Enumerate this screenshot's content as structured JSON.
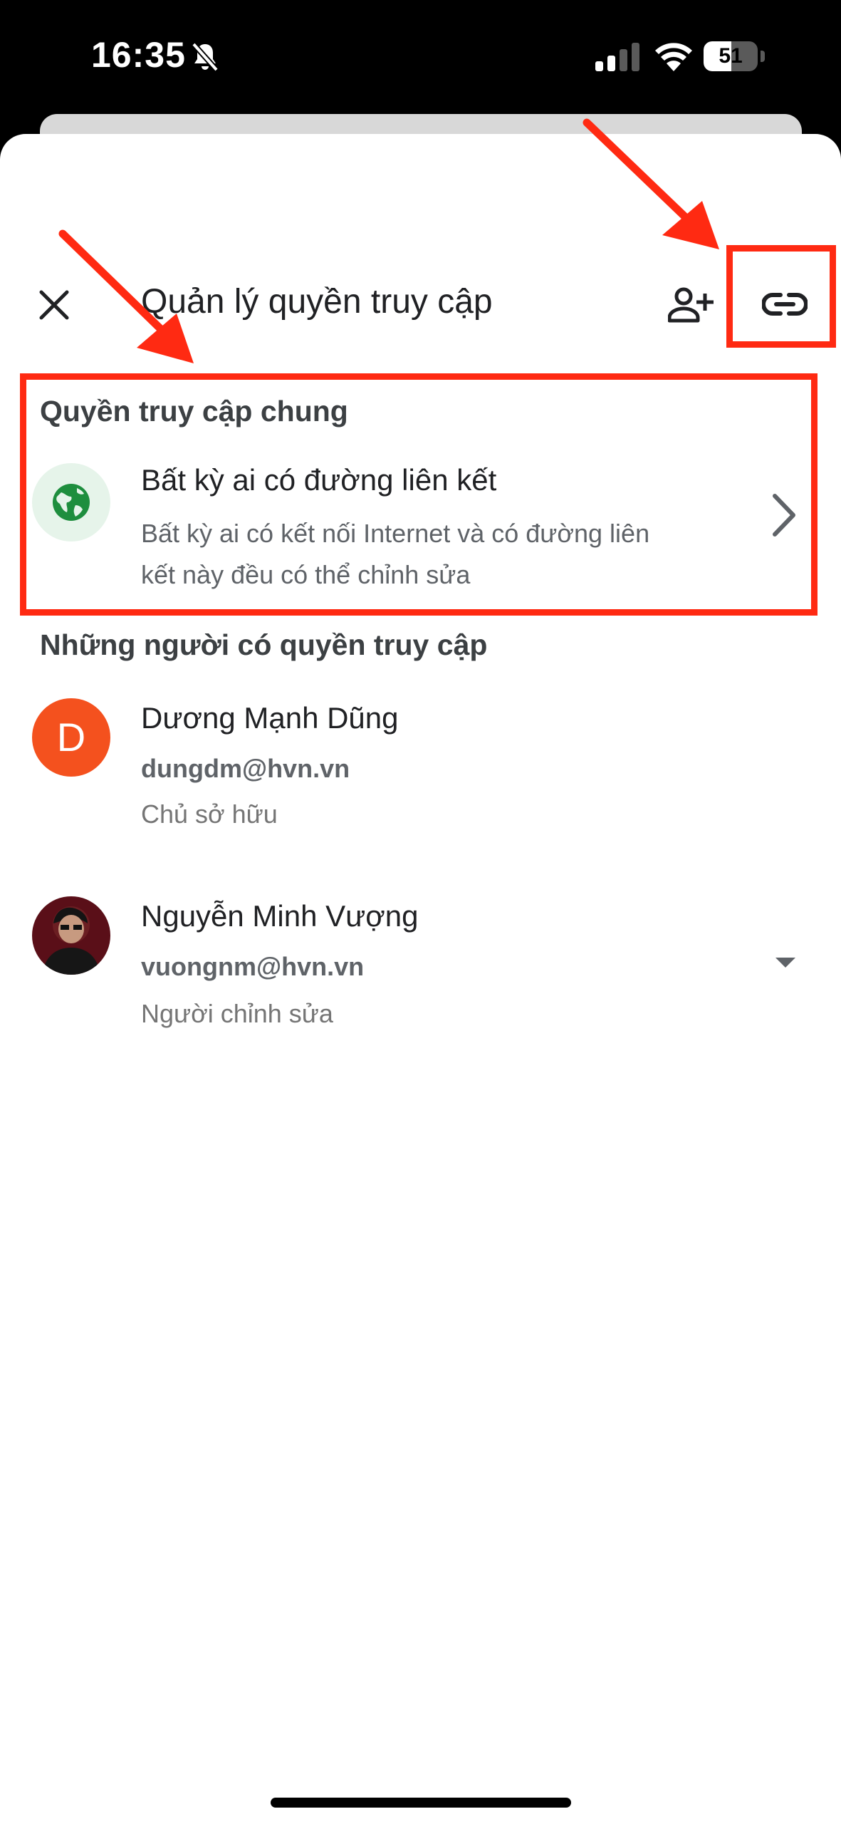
{
  "status_bar": {
    "time": "16:35",
    "battery_level": "51",
    "battery_fraction": 0.51,
    "icons": [
      "bell-slash-icon",
      "cellular-signal-icon",
      "wifi-icon",
      "battery-icon"
    ]
  },
  "header": {
    "title": "Quản lý quyền truy cập",
    "close_icon": "close-icon",
    "add_person_icon": "add-person-icon",
    "link_icon": "link-icon"
  },
  "general_access": {
    "heading": "Quyền truy cập chung",
    "icon": "globe-icon",
    "title": "Bất kỳ ai có đường liên kết",
    "description_line1": "Bất kỳ ai có kết nối Internet và có đường liên",
    "description_line2": "kết này đều có thể chỉnh sửa"
  },
  "people": {
    "heading": "Những người có quyền truy cập",
    "list": [
      {
        "avatar_letter": "D",
        "name": "Dương Mạnh Dũng",
        "email": "dungdm@hvn.vn",
        "role": "Chủ sở hữu"
      },
      {
        "name": "Nguyễn Minh Vượng",
        "email": "vuongnm@hvn.vn",
        "role": "Người chỉnh sửa"
      }
    ]
  },
  "colors": {
    "annotation_red": "#ff2a12",
    "avatar_orange": "#f4511e",
    "globe_green": "#1e8e3e",
    "globe_bg": "#e6f4ea"
  }
}
